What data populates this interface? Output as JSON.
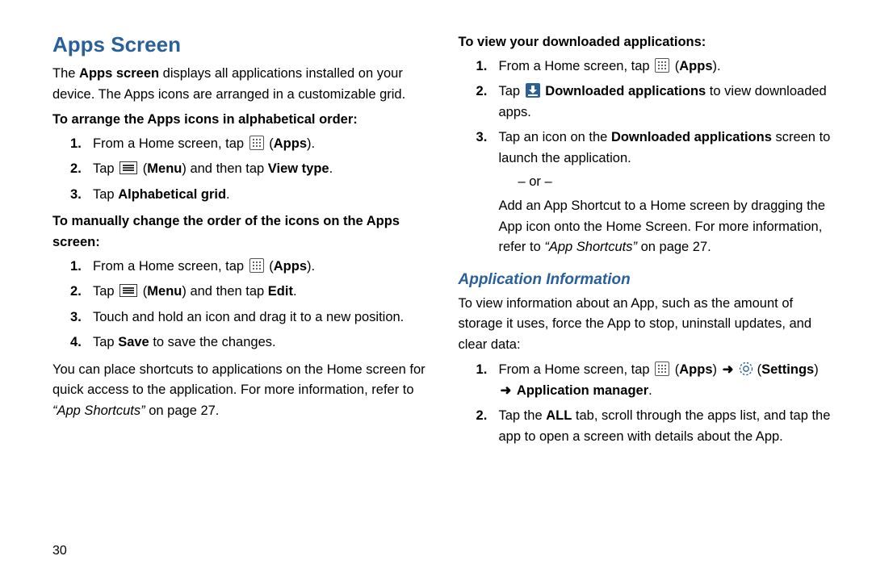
{
  "page_number": "30",
  "left": {
    "title": "Apps Screen",
    "intro_pre": "The ",
    "intro_b1": "Apps screen",
    "intro_post": " displays all applications installed on your device. The Apps icons are arranged in a customizable grid.",
    "sec1_head": "To arrange the Apps icons in alphabetical order:",
    "sec1_s1_a": "From a Home screen, tap ",
    "sec1_s1_b": "Apps",
    "sec1_s2_a": "Tap ",
    "sec1_s2_b": "Menu",
    "sec1_s2_c": " and then tap ",
    "sec1_s2_d": "View type",
    "sec1_s3_a": "Tap ",
    "sec1_s3_b": "Alphabetical grid",
    "sec2_head": "To manually change the order of the icons on the Apps screen:",
    "sec2_s1_a": "From a Home screen, tap ",
    "sec2_s1_b": "Apps",
    "sec2_s2_a": "Tap ",
    "sec2_s2_b": "Menu",
    "sec2_s2_c": " and then tap ",
    "sec2_s2_d": "Edit",
    "sec2_s3": "Touch and hold an icon and drag it to a new position.",
    "sec2_s4_a": "Tap ",
    "sec2_s4_b": "Save",
    "sec2_s4_c": " to save the changes.",
    "footnote_a": "You can place shortcuts to applications on the Home screen for quick access to the application. For more information, refer to ",
    "footnote_i": "“App Shortcuts”",
    "footnote_b": " on page 27."
  },
  "right": {
    "sec3_head": "To view your downloaded applications:",
    "sec3_s1_a": "From a Home screen, tap ",
    "sec3_s1_b": "Apps",
    "sec3_s2_a": "Tap ",
    "sec3_s2_b": "Downloaded applications",
    "sec3_s2_c": " to view downloaded apps.",
    "sec3_s3_a": "Tap an icon on the ",
    "sec3_s3_b": "Downloaded applications",
    "sec3_s3_c": " screen to launch the application.",
    "sec3_or": "– or –",
    "sec3_alt_a": "Add an App Shortcut to a Home screen by dragging the App icon onto the Home Screen. For more information, refer to ",
    "sec3_alt_i": "“App Shortcuts”",
    "sec3_alt_b": " on page 27.",
    "subheading": "Application Information",
    "sub_intro": "To view information about an App, such as the amount of storage it uses, force the App to stop, uninstall updates, and clear data:",
    "sub_s1_a": "From a Home screen, tap ",
    "sub_s1_b": "Apps",
    "sub_s1_c": "Settings",
    "sub_s1_d": "Application manager",
    "sub_s2_a": "Tap the ",
    "sub_s2_b": "ALL",
    "sub_s2_c": " tab, scroll through the apps list, and tap the app to open a screen with details about the App.",
    "arrow": "➜"
  }
}
